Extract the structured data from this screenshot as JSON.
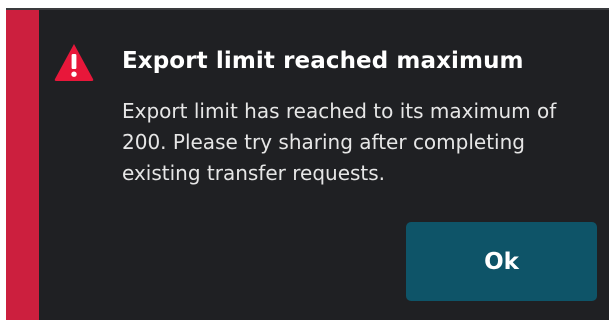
{
  "dialog": {
    "title": "Export limit reached maximum",
    "message": "Export limit has reached to its maximum of 200. Please try sharing after completing existing transfer requests.",
    "icon": "warning-triangle-icon",
    "ok_label": "Ok"
  },
  "colors": {
    "background": "#1f2023",
    "accent_bar": "#cc1f3e",
    "icon": "#e8173a",
    "button": "#0e5468",
    "text": "#ffffff"
  }
}
